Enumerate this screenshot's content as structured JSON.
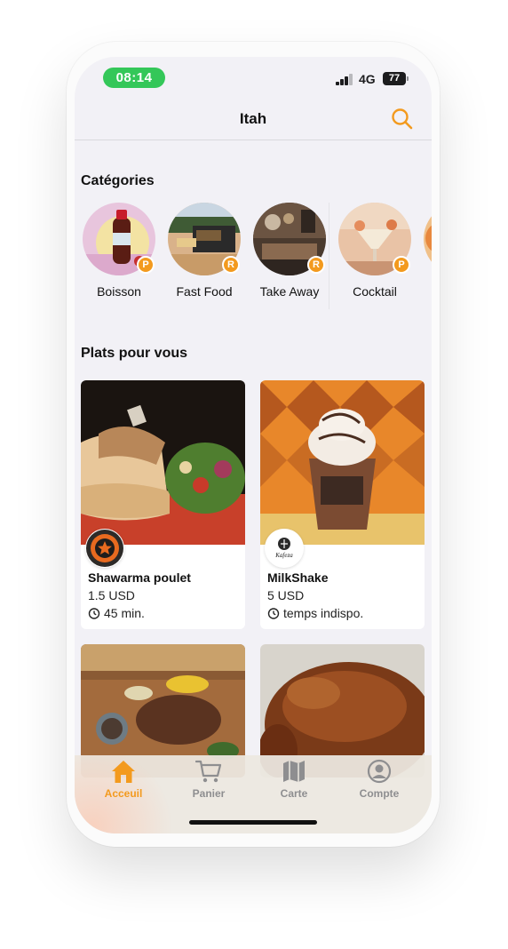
{
  "status_bar": {
    "time": "08:14",
    "network": "4G",
    "battery": "77"
  },
  "header": {
    "title": "Itah"
  },
  "categories": {
    "title": "Catégories",
    "items": [
      {
        "label": "Boisson",
        "badge": "P"
      },
      {
        "label": "Fast Food",
        "badge": "R"
      },
      {
        "label": "Take Away",
        "badge": "R"
      },
      {
        "label": "Cocktail",
        "badge": "P"
      }
    ]
  },
  "dishes": {
    "title": "Plats pour vous",
    "items": [
      {
        "name": "Shawarma poulet",
        "price": "1.5 USD",
        "time": "45 min."
      },
      {
        "name": "MilkShake",
        "price": "5 USD",
        "time": "temps indispo.",
        "logo_text": "Kafeza"
      }
    ]
  },
  "tab_bar": {
    "items": [
      {
        "label": "Acceuil",
        "icon": "home-icon",
        "active": true
      },
      {
        "label": "Panier",
        "icon": "cart-icon",
        "active": false
      },
      {
        "label": "Carte",
        "icon": "map-icon",
        "active": false
      },
      {
        "label": "Compte",
        "icon": "account-icon",
        "active": false
      }
    ]
  },
  "colors": {
    "accent": "#f39a1e",
    "status_pill": "#34c759",
    "background": "#f2f1f6"
  }
}
